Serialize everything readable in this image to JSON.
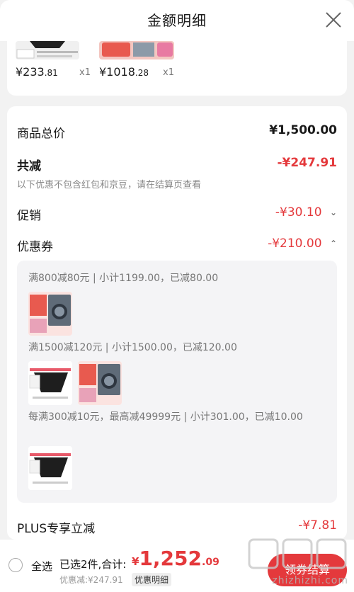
{
  "header": {
    "title": "金额明细"
  },
  "top_items": [
    {
      "price_int": "¥233",
      "price_dec": ".81",
      "qty": "x1"
    },
    {
      "price_int": "¥1018",
      "price_dec": ".28",
      "qty": "x1"
    }
  ],
  "summary": {
    "total_label": "商品总价",
    "total_value": "¥1,500.00",
    "reduce_label": "共减",
    "reduce_value": "-¥247.91",
    "reduce_note": "以下优惠不包含红包和京豆，请在结算页查看",
    "promo_label": "促销",
    "promo_value": "-¥30.10",
    "coupon_label": "优惠券",
    "coupon_value": "-¥210.00",
    "plus_label": "PLUS专享立减",
    "plus_value": "-¥7.81"
  },
  "coupons": [
    {
      "text": "满800减80元 | 小计1199.00，已减80.00"
    },
    {
      "text": "满1500减120元 | 小计1500.00，已减120.00"
    },
    {
      "text": "每满300减10元，最高减49999元 | 小计301.00，已减10.00"
    }
  ],
  "bottom_bar": {
    "select_all": "全选",
    "selected_summary": "已选2件,合计:",
    "total_currency": "¥",
    "total_int": "1,252",
    "total_dec": ".09",
    "discount_text": "优惠减:¥247.91",
    "detail_link": "优惠明细",
    "checkout": "领券结算"
  },
  "watermark": {
    "text": "zhizhizhi.com"
  },
  "colors": {
    "accent": "#e4393c",
    "background": "#f2f2f2"
  }
}
